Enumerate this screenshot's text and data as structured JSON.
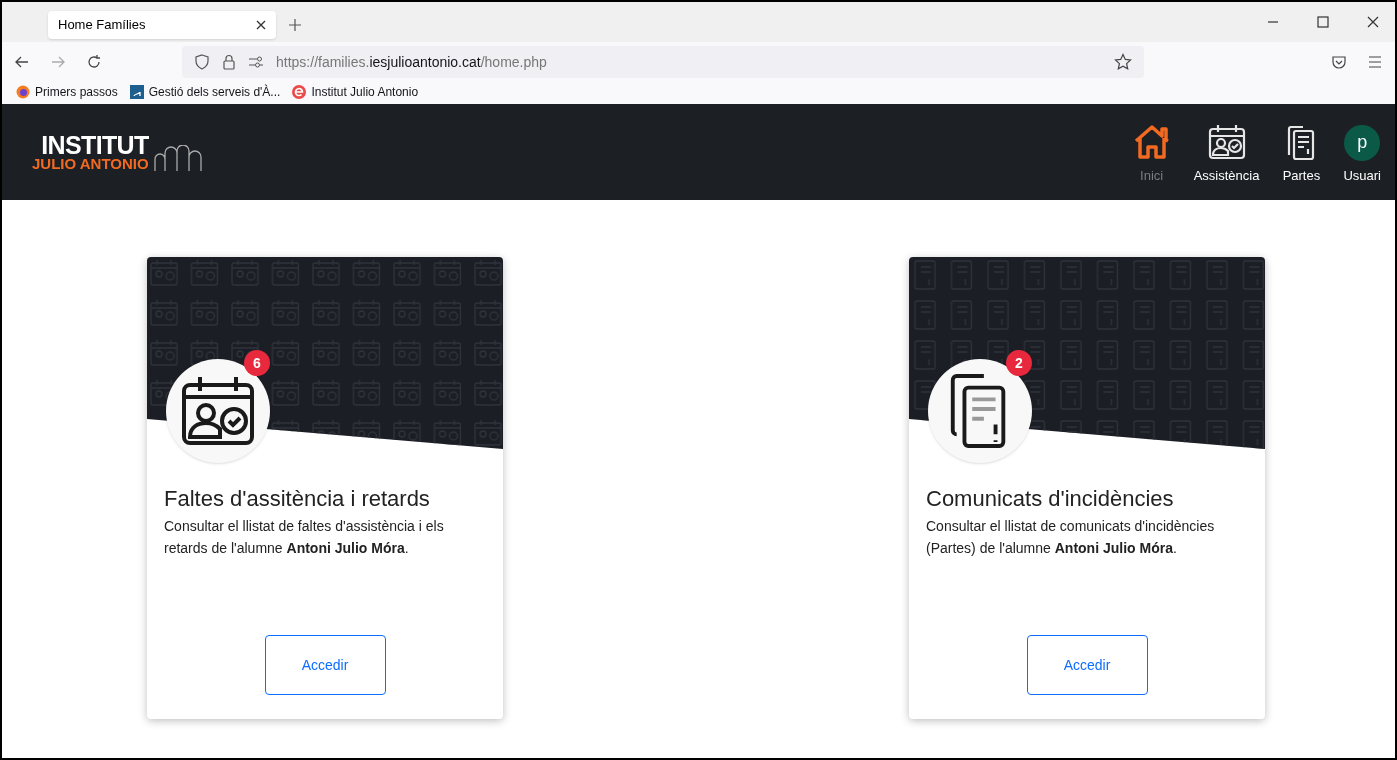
{
  "browser": {
    "tabs": [
      {
        "title": "Home Famílies",
        "selected": true
      }
    ],
    "url": {
      "prefix": "https://families.",
      "domain": "iesjulioantonio.cat",
      "path": "/home.php"
    },
    "bookmarks": [
      "Primers passos",
      "Gestió dels serveis d'À...",
      "Institut Julio Antonio"
    ]
  },
  "nav": {
    "logo": {
      "line_1": "INSTITUT",
      "line_2": "JULIO ANTONIO"
    },
    "items": [
      {
        "label": "Inici",
        "selected": true
      },
      {
        "label": "Assistència",
        "selected": false
      },
      {
        "label": "Partes",
        "selected": false
      },
      {
        "label": "Usuari",
        "selected": false,
        "avatar": "p"
      }
    ]
  },
  "cards": [
    {
      "badge": "6",
      "title": "Faltes d'assitència i retards",
      "description": "Consultar el llistat de faltes d'assistència i els retards de l'alumne **Antoni Julio Móra**.",
      "button": "Accedir"
    },
    {
      "badge": "2",
      "title": "Comunicats d'incidències",
      "description": "Consultar el llistat de comunicats d'incidències (Partes) de l'alumne **Antoni Julio Móra**.",
      "button": "Accedir"
    }
  ]
}
